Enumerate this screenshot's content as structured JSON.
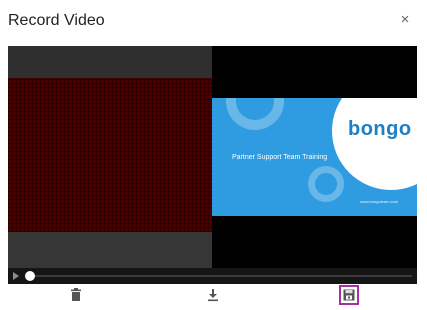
{
  "dialog": {
    "title": "Record Video",
    "close_glyph": "×",
    "close_icon": "close-icon"
  },
  "recording": {
    "slide": {
      "brand": "bongo",
      "subtitle": "Partner Support Team Training",
      "url": "www.bongolearn.com",
      "accent_color": "#2f9be0"
    },
    "playback_progress": 0
  },
  "toolbar": {
    "tools": [
      {
        "icon": "trash-icon",
        "selected": false
      },
      {
        "icon": "download-icon",
        "selected": false
      },
      {
        "icon": "save-icon",
        "selected": true
      }
    ],
    "selection_color": "#a033a0"
  }
}
